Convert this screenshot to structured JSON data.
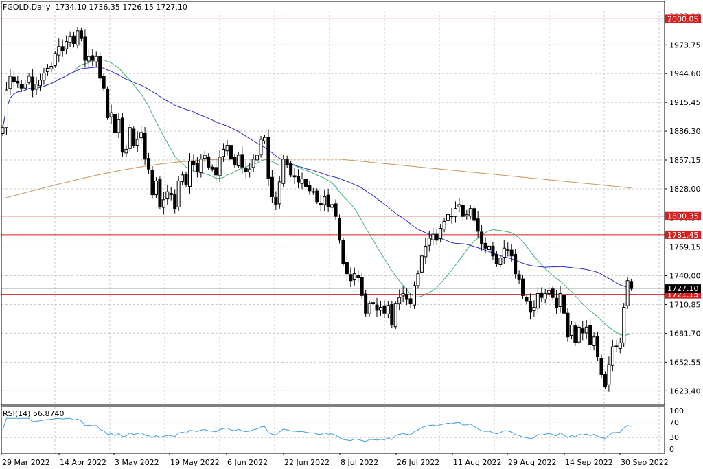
{
  "header": {
    "symbol": "FGOLD,Daily",
    "ohlc": "1734.10 1736.35 1726.15 1727.10"
  },
  "rsi_header": {
    "label": "RSI(14)",
    "value": "56.8740"
  },
  "colors": {
    "grid": "#c8c8c8",
    "candle": "#000000",
    "ma_fast": "#3cb371",
    "ma_mid": "#2b2bcc",
    "ma_slow": "#c8965a",
    "level": "#d42020",
    "rsi_line": "#3b9be8"
  },
  "chart_data": [
    {
      "type": "candlestick",
      "y_axis": {
        "range": [
          1609,
          2008
        ],
        "ticks": [
          "1623.40",
          "1652.55",
          "1681.70",
          "1710.85",
          "1740.00",
          "1769.15",
          "1798.30",
          "1828.00",
          "1857.15",
          "1886.30",
          "1915.45",
          "1944.60",
          "1973.75",
          "2002.90"
        ]
      },
      "x_axis": {
        "tick_labels": [
          "29 Mar 2022",
          "14 Apr 2022",
          "3 May 2022",
          "19 May 2022",
          "6 Jun 2022",
          "22 Jun 2022",
          "8 Jul 2022",
          "26 Jul 2022",
          "11 Aug 2022",
          "29 Aug 2022",
          "14 Sep 2022",
          "30 Sep 2022"
        ]
      },
      "grid": true,
      "closes": [
        1890,
        1928,
        1942,
        1936,
        1935,
        1930,
        1934,
        1942,
        1928,
        1934,
        1938,
        1945,
        1950,
        1952,
        1965,
        1972,
        1968,
        1977,
        1982,
        1975,
        1988,
        1980,
        1958,
        1962,
        1958,
        1962,
        1940,
        1930,
        1900,
        1905,
        1885,
        1898,
        1865,
        1868,
        1890,
        1872,
        1878,
        1885,
        1858,
        1848,
        1822,
        1836,
        1810,
        1817,
        1825,
        1822,
        1808,
        1836,
        1842,
        1832,
        1856,
        1852,
        1845,
        1858,
        1862,
        1850,
        1848,
        1842,
        1860,
        1868,
        1872,
        1858,
        1852,
        1862,
        1850,
        1845,
        1848,
        1858,
        1862,
        1878,
        1880,
        1838,
        1820,
        1812,
        1835,
        1858,
        1852,
        1842,
        1840,
        1835,
        1838,
        1830,
        1826,
        1825,
        1815,
        1812,
        1820,
        1810,
        1812,
        1800,
        1776,
        1752,
        1742,
        1735,
        1742,
        1738,
        1720,
        1702,
        1712,
        1712,
        1705,
        1708,
        1702,
        1710,
        1690,
        1712,
        1718,
        1722,
        1716,
        1712,
        1730,
        1742,
        1760,
        1770,
        1778,
        1782,
        1776,
        1788,
        1795,
        1802,
        1800,
        1808,
        1812,
        1800,
        1802,
        1808,
        1796,
        1785,
        1772,
        1768,
        1770,
        1760,
        1752,
        1758,
        1768,
        1766,
        1760,
        1742,
        1736,
        1720,
        1714,
        1703,
        1708,
        1722,
        1718,
        1722,
        1725,
        1718,
        1708,
        1722,
        1702,
        1678,
        1690,
        1672,
        1688,
        1682,
        1688,
        1670,
        1678,
        1658,
        1640,
        1628,
        1650,
        1668,
        1668,
        1672,
        1708,
        1735,
        1727
      ],
      "moving_averages": [
        {
          "color_key": "ma_fast",
          "period": 20
        },
        {
          "color_key": "ma_mid",
          "period": 50
        },
        {
          "color_key": "ma_slow",
          "period": 200
        }
      ],
      "levels": [
        {
          "value": 2000.05,
          "label": "2000.05"
        },
        {
          "value": 1800.35,
          "label": "1800.35"
        },
        {
          "value": 1781.45,
          "label": "1781.45"
        },
        {
          "value": 1721.15,
          "label": "1721.15"
        }
      ],
      "current_price": {
        "value": 1727.1,
        "label": "1727.10"
      }
    },
    {
      "type": "line",
      "name": "RSI(14)",
      "y_axis": {
        "range": [
          0,
          100
        ],
        "ticks": [
          "0",
          "30",
          "70",
          "100"
        ]
      }
    }
  ]
}
